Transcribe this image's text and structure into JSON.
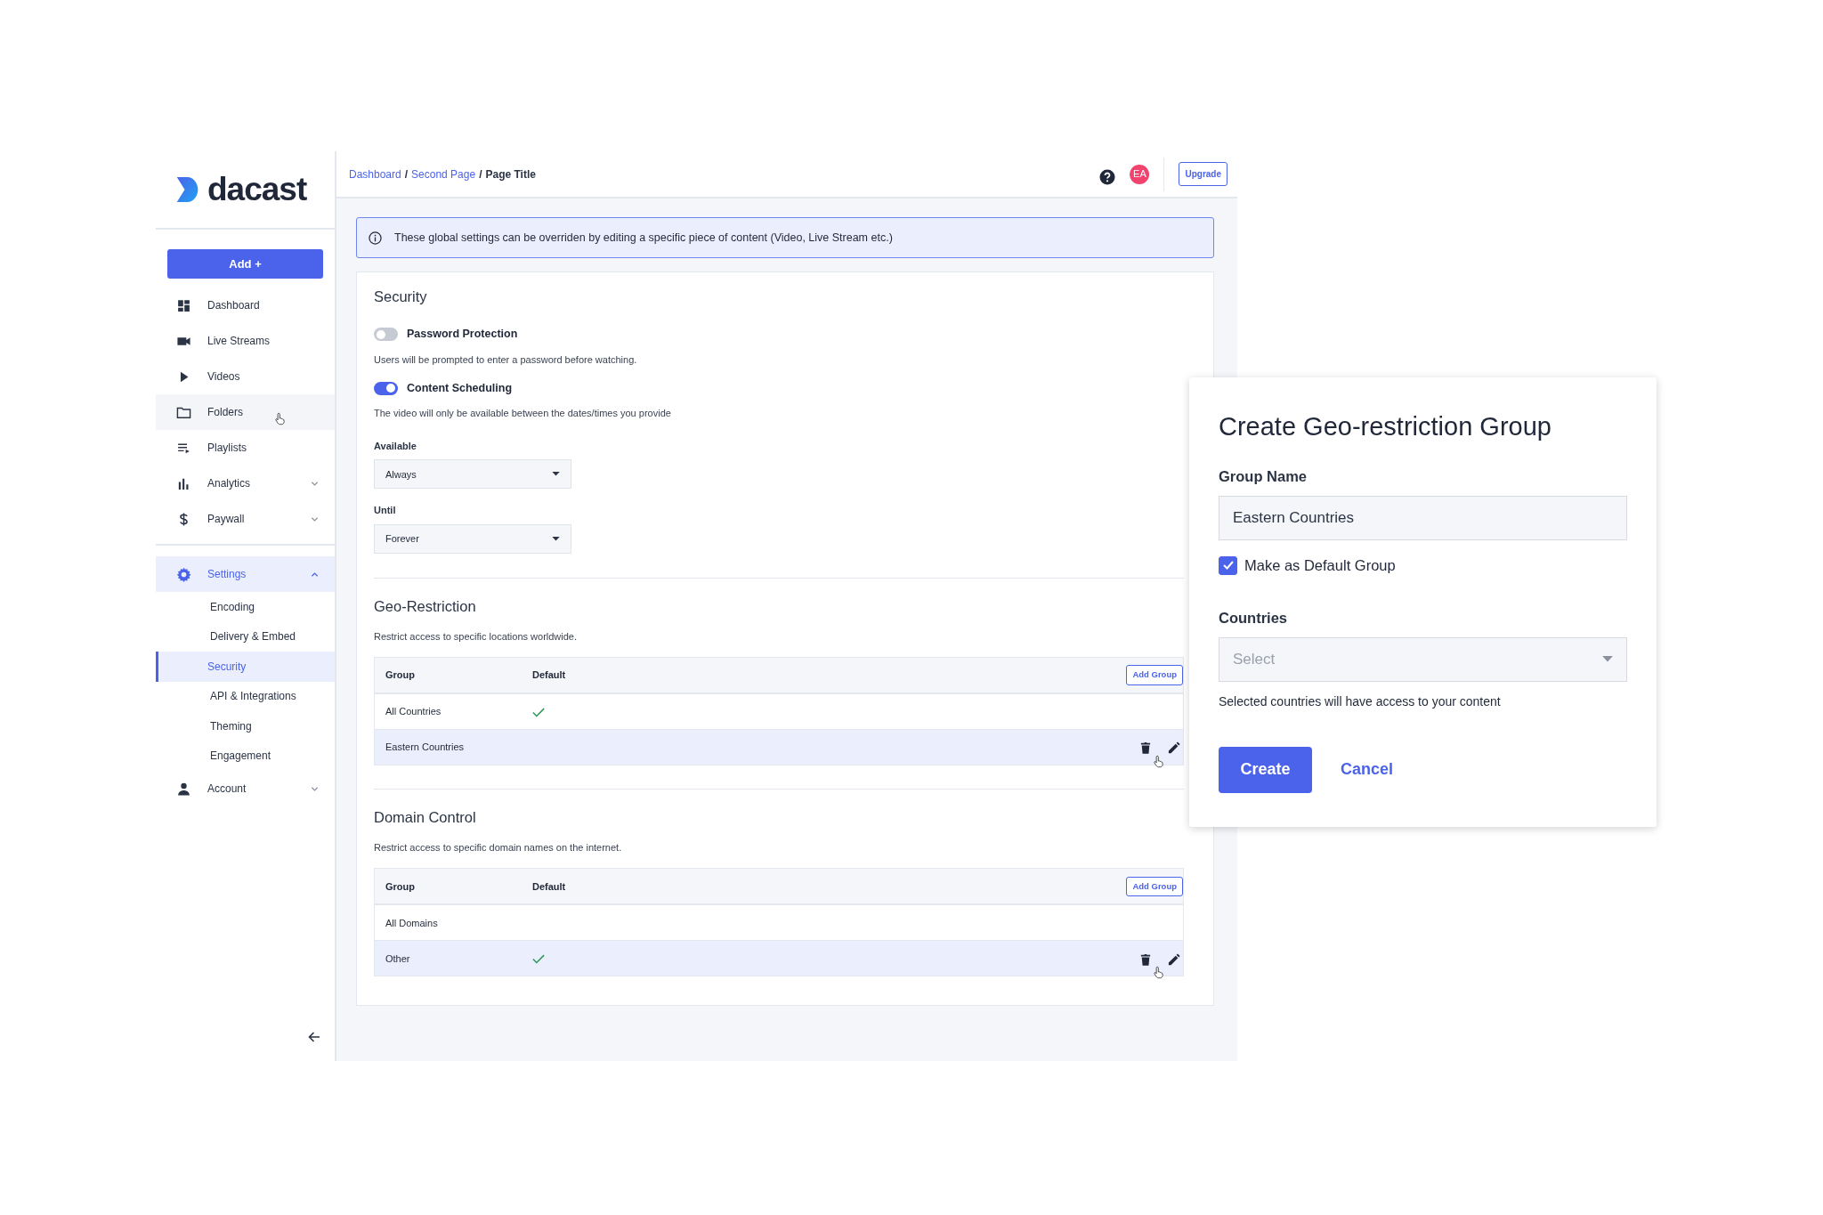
{
  "sidebar": {
    "logo": "dacast",
    "add_button": "Add +",
    "items": [
      {
        "label": "Dashboard",
        "selected": false,
        "hovered": false
      },
      {
        "label": "Live Streams",
        "selected": false,
        "hovered": false
      },
      {
        "label": "Videos",
        "selected": false,
        "hovered": false
      },
      {
        "label": "Folders",
        "selected": false,
        "hovered": true
      },
      {
        "label": "Playlists",
        "selected": false,
        "hovered": false
      },
      {
        "label": "Analytics",
        "selected": false,
        "hovered": false,
        "expanded": false
      },
      {
        "label": "Paywall",
        "selected": false,
        "hovered": false,
        "expanded": false
      },
      {
        "label": "Settings",
        "selected": true,
        "hovered": false,
        "expanded": true,
        "children": [
          {
            "label": "Encoding",
            "selected": false
          },
          {
            "label": "Delivery & Embed",
            "selected": false
          },
          {
            "label": "Security",
            "selected": true
          },
          {
            "label": "API & Integrations",
            "selected": false
          },
          {
            "label": "Theming",
            "selected": false
          },
          {
            "label": "Engagement",
            "selected": false
          }
        ]
      },
      {
        "label": "Account",
        "selected": false,
        "hovered": false,
        "expanded": false
      }
    ]
  },
  "header": {
    "breadcrumb": [
      {
        "kind": "link",
        "text": "Dashboard"
      },
      {
        "kind": "separator",
        "text": "/"
      },
      {
        "kind": "link",
        "text": "Second Page"
      },
      {
        "kind": "separator",
        "text": "/"
      },
      {
        "kind": "current",
        "text": "Page Title"
      }
    ],
    "avatar": "EA",
    "upgrade_button": "Upgrade"
  },
  "notice": "These global settings can be overriden by editing a specific piece of content (Video, Live Stream etc.)",
  "security": {
    "title": "Security",
    "toggles": [
      {
        "label": "Password Protection",
        "description": "Users will be prompted to enter a password before watching.",
        "on": false
      },
      {
        "label": "Content Scheduling",
        "description": "The video will only be available between the dates/times you provide",
        "on": true
      }
    ],
    "selects": [
      {
        "label": "Available",
        "value": "Always"
      },
      {
        "label": "Until",
        "value": "Forever"
      }
    ]
  },
  "sections": [
    {
      "title": "Geo-Restriction",
      "description": "Restrict access to specific locations worldwide.",
      "columns": [
        "Group",
        "Default"
      ],
      "add_button": "Add Group",
      "rows": [
        {
          "group": "All Countries",
          "default": true,
          "hovered": false
        },
        {
          "group": "Eastern Countries",
          "default": false,
          "hovered": true
        }
      ]
    },
    {
      "title": "Domain Control",
      "description": "Restrict access to specific domain names on the internet.",
      "columns": [
        "Group",
        "Default"
      ],
      "add_button": "Add Group",
      "rows": [
        {
          "group": "All Domains",
          "default": false,
          "hovered": false
        },
        {
          "group": "Other",
          "default": true,
          "hovered": true
        }
      ]
    }
  ],
  "dialog": {
    "title": "Create Geo-restriction Group",
    "group_name_label": "Group Name",
    "group_name_value": "Eastern Countries",
    "default_checkbox": {
      "label": "Make as Default Group",
      "checked": true
    },
    "countries_label": "Countries",
    "countries_placeholder": "Select",
    "countries_help": "Selected countries will have access to your content",
    "create_button": "Create",
    "cancel_button": "Cancel"
  }
}
